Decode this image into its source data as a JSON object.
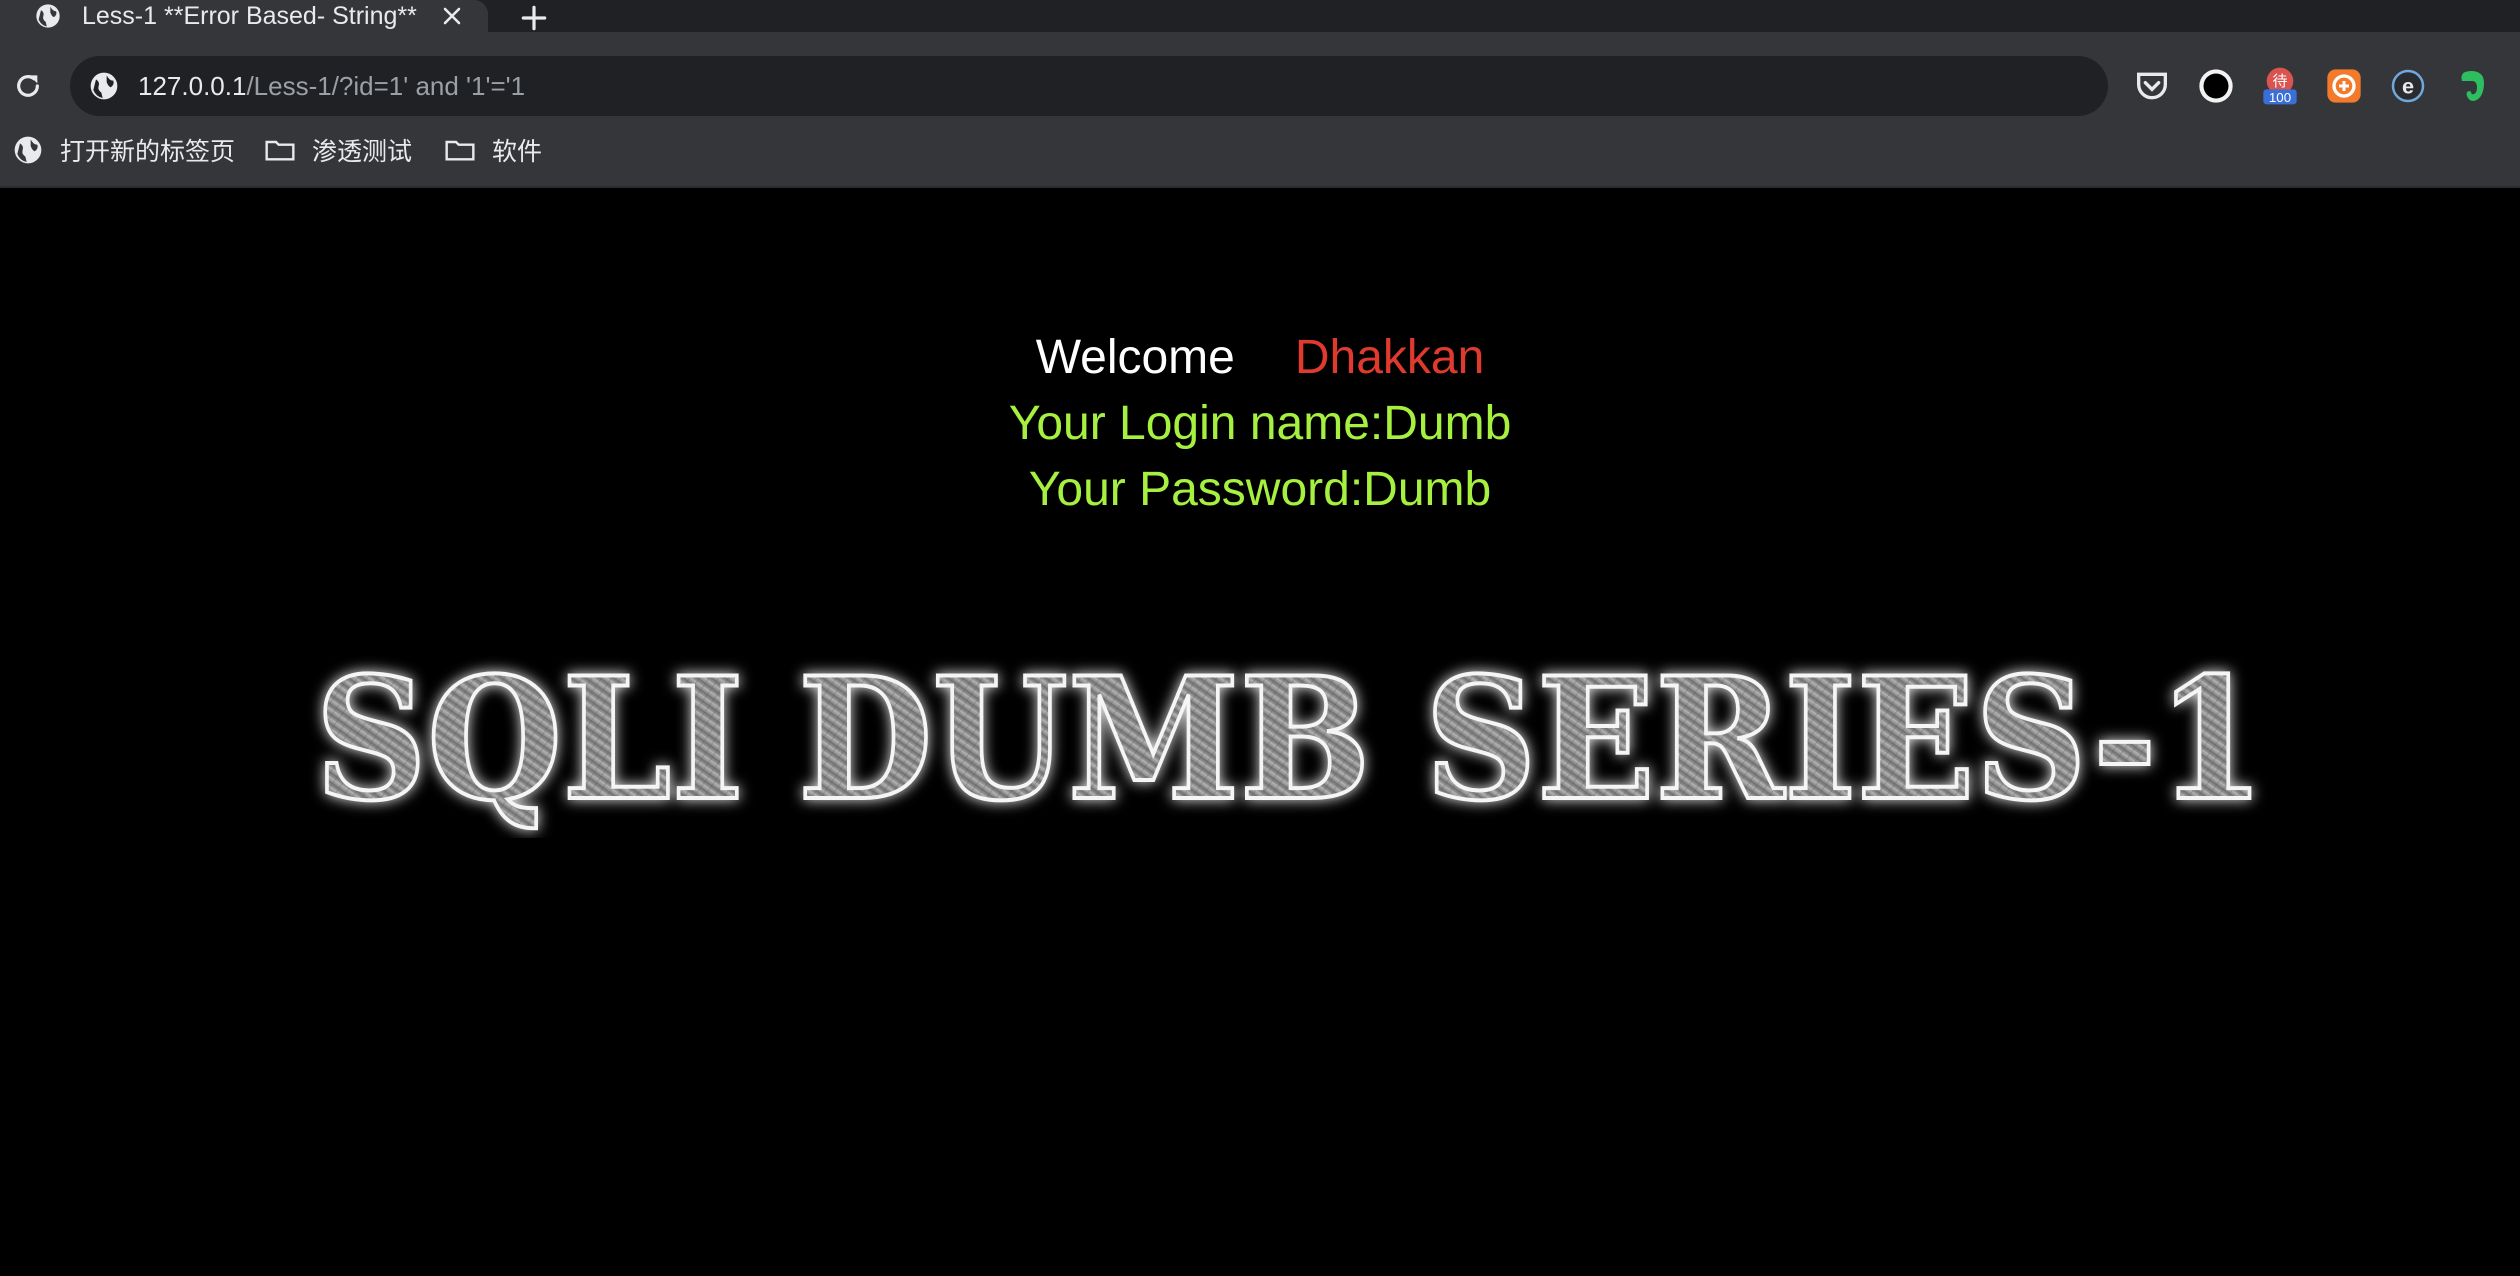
{
  "browser": {
    "tab_title": "Less-1 **Error Based- String**",
    "url_host": "127.0.0.1",
    "url_path": "/Less-1/?id=1' and '1'='1",
    "extensions": [
      {
        "name": "pocket",
        "badge": ""
      },
      {
        "name": "record",
        "badge": ""
      },
      {
        "name": "todo",
        "badge": "100"
      },
      {
        "name": "orange-extension",
        "badge": ""
      },
      {
        "name": "ie-extension",
        "badge": ""
      },
      {
        "name": "evernote",
        "badge": ""
      }
    ],
    "bookmarks": [
      {
        "label": "打开新的标签页",
        "icon": "globe-icon"
      },
      {
        "label": "渗透测试",
        "icon": "folder-icon"
      },
      {
        "label": "软件",
        "icon": "folder-icon"
      }
    ]
  },
  "page": {
    "welcome": "Welcome",
    "name": "Dhakkan",
    "login_line": "Your Login name:Dumb",
    "password_line": "Your Password:Dumb",
    "banner_text": "SQLI DUMB SERIES-1"
  },
  "colors": {
    "welcome": "#ffffff",
    "name": "#e03a2f",
    "info": "#a6f040",
    "background": "#000000"
  }
}
